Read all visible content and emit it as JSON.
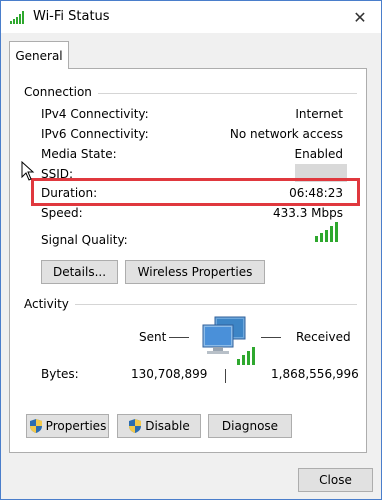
{
  "window": {
    "title": "Wi-Fi Status",
    "close_label": "✕"
  },
  "tabs": [
    {
      "label": "General"
    }
  ],
  "connection": {
    "group_label": "Connection",
    "rows": [
      {
        "label": "IPv4 Connectivity:",
        "value": "Internet"
      },
      {
        "label": "IPv6 Connectivity:",
        "value": "No network access"
      },
      {
        "label": "Media State:",
        "value": "Enabled"
      },
      {
        "label": "SSID:",
        "value": ""
      },
      {
        "label": "Duration:",
        "value": "06:48:23"
      },
      {
        "label": "Speed:",
        "value": "433.3 Mbps"
      }
    ],
    "signal_quality_label": "Signal Quality:",
    "details_button": "Details...",
    "wireless_properties_button": "Wireless Properties"
  },
  "activity": {
    "group_label": "Activity",
    "sent_label": "Sent",
    "received_label": "Received",
    "bytes_label": "Bytes:",
    "bytes_sent": "130,708,899",
    "bytes_received": "1,868,556,996"
  },
  "buttons": {
    "properties": "Properties",
    "disable": "Disable",
    "diagnose": "Diagnose",
    "close": "Close"
  },
  "colors": {
    "signal_green": "#2ea82e",
    "highlight_red": "#e0383e"
  }
}
